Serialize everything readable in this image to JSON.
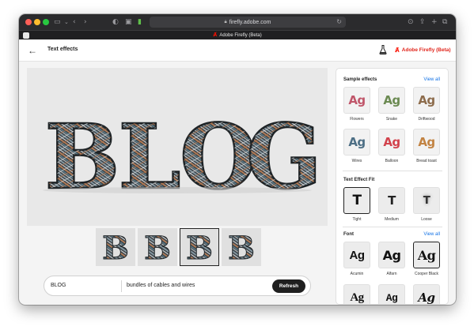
{
  "browser": {
    "url": "firefly.adobe.com",
    "tab_title": "Adobe Firefly (Beta)"
  },
  "header": {
    "title": "Text effects",
    "brand": "Adobe Firefly (Beta)"
  },
  "canvas": {
    "text": "BLOG"
  },
  "thumbnails": {
    "letters": [
      "B",
      "B",
      "B",
      "B"
    ],
    "selected_index": 2
  },
  "prompt": {
    "text": "BLOG",
    "description": "bundles of cables and wires",
    "button": "Refresh"
  },
  "sample_effects": {
    "title": "Sample effects",
    "view_all": "View all",
    "glyph": "Ag",
    "items": [
      {
        "label": "Flowers"
      },
      {
        "label": "Snake"
      },
      {
        "label": "Driftwood"
      },
      {
        "label": "Wires"
      },
      {
        "label": "Balloon"
      },
      {
        "label": "Bread toast"
      }
    ]
  },
  "text_effect_fit": {
    "title": "Text Effect Fit",
    "glyph": "T",
    "items": [
      {
        "label": "Tight"
      },
      {
        "label": "Medium"
      },
      {
        "label": "Loose"
      }
    ],
    "selected": "Tight"
  },
  "font": {
    "title": "Font",
    "view_all": "View all",
    "glyph": "Ag",
    "items": [
      {
        "label": "Acumin"
      },
      {
        "label": "Alfarn"
      },
      {
        "label": "Cooper Black"
      }
    ],
    "selected": "Cooper Black"
  },
  "colors": {
    "accent": "#1473e6",
    "brand": "#e1251b",
    "button": "#1f1f1f"
  }
}
